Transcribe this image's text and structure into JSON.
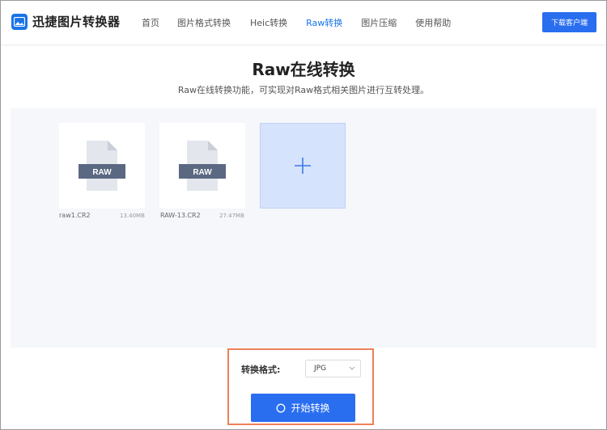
{
  "app": {
    "name": "迅捷图片转换器"
  },
  "nav": {
    "items": [
      {
        "label": "首页"
      },
      {
        "label": "图片格式转换"
      },
      {
        "label": "Heic转换"
      },
      {
        "label": "Raw转换"
      },
      {
        "label": "图片压缩"
      },
      {
        "label": "使用帮助"
      }
    ],
    "active_index": 3,
    "download_label": "下载客户端"
  },
  "page": {
    "title": "Raw在线转换",
    "subtitle": "Raw在线转换功能，可实现对Raw格式相关图片进行互转处理。"
  },
  "files": [
    {
      "name": "raw1.CR2",
      "size": "13.40MB",
      "badge": "RAW"
    },
    {
      "name": "RAW-13.CR2",
      "size": "27.47MB",
      "badge": "RAW"
    }
  ],
  "add_tile": {
    "icon": "plus-icon"
  },
  "convert": {
    "format_label": "转换格式:",
    "format_value": "JPG",
    "start_label": "开始转换"
  },
  "colors": {
    "accent": "#2a6ef0",
    "nav_active": "#1a73e8",
    "add_tile_bg": "#d6e3fc",
    "highlight_border": "#ee7f58",
    "badge": "#5b6882"
  }
}
